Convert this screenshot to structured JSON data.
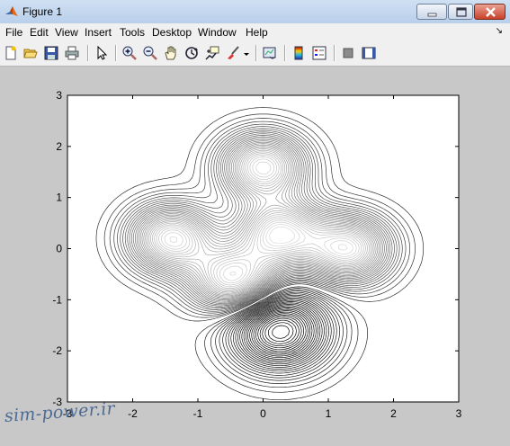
{
  "window": {
    "title": "Figure 1",
    "icon": "matlab-logo-icon",
    "controls": [
      "minimize-icon",
      "maximize-icon",
      "close-icon"
    ]
  },
  "menubar": {
    "items": [
      "File",
      "Edit",
      "View",
      "Insert",
      "Tools",
      "Desktop",
      "Window",
      "Help"
    ],
    "dock_arrow": "↘"
  },
  "toolbar": {
    "icons": [
      "new-figure-icon",
      "open-file-icon",
      "save-icon",
      "print-icon",
      "edit-plot-arrow-icon",
      "zoom-in-icon",
      "zoom-out-icon",
      "pan-hand-icon",
      "rotate-3d-icon",
      "data-cursor-icon",
      "brush-icon",
      "brush-dropdown-icon",
      "link-plot-icon",
      "insert-colorbar-icon",
      "insert-legend-icon",
      "hide-plot-tools-icon",
      "show-plot-tools-icon"
    ]
  },
  "chart_data": {
    "type": "contour",
    "title": "",
    "xlabel": "",
    "ylabel": "",
    "xlim": [
      -3,
      3
    ],
    "ylim": [
      -3,
      3
    ],
    "xticks": [
      -3,
      -2,
      -1,
      0,
      1,
      2,
      3
    ],
    "yticks": [
      -3,
      -2,
      -1,
      0,
      1,
      2,
      3
    ],
    "xtick_labels": [
      "-3",
      "-2",
      "-1",
      "0",
      "1",
      "2",
      "3"
    ],
    "ytick_labels": [
      "3",
      "2",
      "1",
      "0",
      "-1",
      "-2",
      "-3"
    ],
    "grid": false,
    "colormap": "gray",
    "features": [
      {
        "kind": "peak",
        "x": 0.0,
        "y": 1.6
      },
      {
        "kind": "peak",
        "x": -1.4,
        "y": 0.2
      },
      {
        "kind": "peak",
        "x": 0.25,
        "y": 0.3
      },
      {
        "kind": "peak",
        "x": 1.3,
        "y": 0.0
      },
      {
        "kind": "peak",
        "x": -0.45,
        "y": -0.6
      },
      {
        "kind": "trough",
        "x": 0.25,
        "y": -1.6
      }
    ]
  },
  "watermark": {
    "text": "sim-power.ir",
    "color": "#4d6c93"
  }
}
